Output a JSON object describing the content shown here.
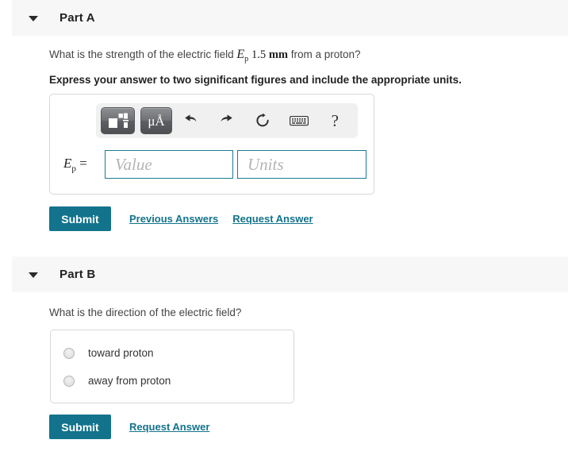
{
  "parts": {
    "a": {
      "title": "Part A",
      "caret_icon": "caret-down-icon",
      "question_prefix": "What is the strength of the electric field",
      "question_symbol": "E",
      "question_symbol_sub": "p",
      "question_distance": "1.5",
      "question_unit": "mm",
      "question_suffix": "from a proton?",
      "instruction": "Express your answer to two significant figures and include the appropriate units.",
      "equation_label_symbol": "E",
      "equation_label_sub": "p",
      "equation_label_equals": "=",
      "value_placeholder": "Value",
      "units_placeholder": "Units",
      "value_current": "",
      "units_current": "",
      "toolbar": {
        "template_button": "math-template-icon",
        "units_button": "μÅ",
        "undo": "undo-icon",
        "redo": "redo-icon",
        "reset": "reset-icon",
        "keyboard": "keyboard-icon",
        "help": "?"
      },
      "submit_label": "Submit",
      "previous_answers_label": "Previous Answers",
      "request_answer_label": "Request Answer"
    },
    "b": {
      "title": "Part B",
      "caret_icon": "caret-down-icon",
      "question": "What is the direction of the electric field?",
      "options": [
        {
          "label": "toward proton",
          "selected": false
        },
        {
          "label": "away from proton",
          "selected": false
        }
      ],
      "submit_label": "Submit",
      "request_answer_label": "Request Answer"
    }
  },
  "colors": {
    "accent": "#13738c",
    "header_band": "#f7f7f7",
    "field_border": "#1c7b93",
    "box_border": "#d8d8d8"
  }
}
